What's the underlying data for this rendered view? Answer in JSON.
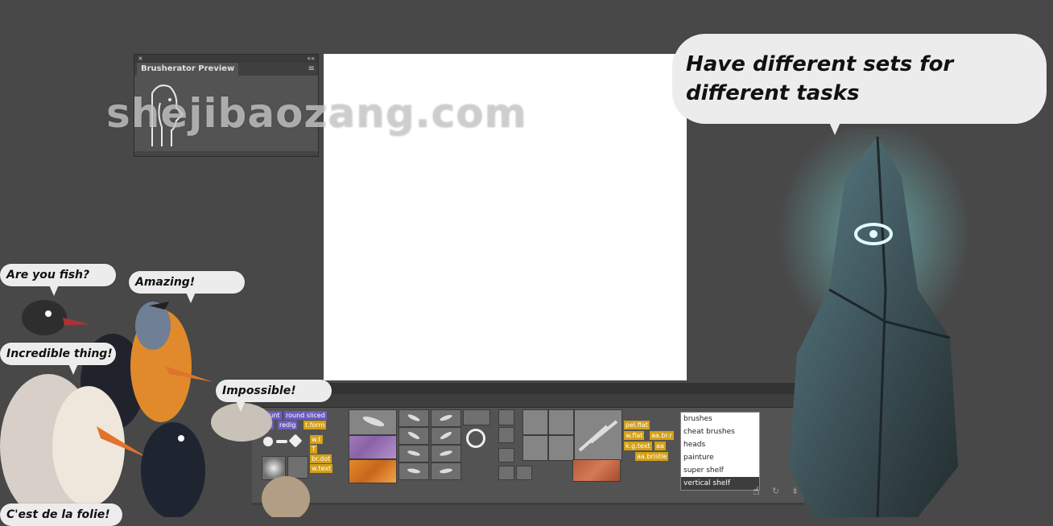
{
  "watermark": "shejibaozang.com",
  "preview_panel": {
    "close_glyph": "×",
    "collapse_glyph": "««",
    "tab_title": "Brusherator Preview",
    "menu_glyph": "≡"
  },
  "speech": {
    "main": "Have different sets for different tasks",
    "fish": "Are you fish?",
    "amazing": "Amazing!",
    "incredible": "Incredible thing!",
    "impossible": "Impossible!",
    "folie": "C'est de la folie!"
  },
  "shelf": {
    "tags_purple": [
      "blunt",
      "round sliced",
      "tilt",
      "redig"
    ],
    "tags_orange_left": [
      "t.form",
      "w.t",
      "T",
      "br.dot",
      "w.text"
    ],
    "tags_orange_right": [
      "pel.flat",
      "w.flat",
      "aa.br.r",
      "k.g.text",
      "aa",
      "aa.bristle"
    ],
    "brush_sets": [
      "brushes",
      "cheat brushes",
      "heads",
      "painture",
      "super shelf",
      "vertical shelf"
    ],
    "selected_set": "vertical shelf",
    "icons": [
      "refresh-icon",
      "pin-icon",
      "brush-icon",
      "eraser-icon"
    ]
  },
  "colors": {
    "background": "#484848",
    "tag_purple": "#6b5bc2",
    "tag_orange": "#d4a017",
    "eye_glow": "#7fe8ea"
  }
}
